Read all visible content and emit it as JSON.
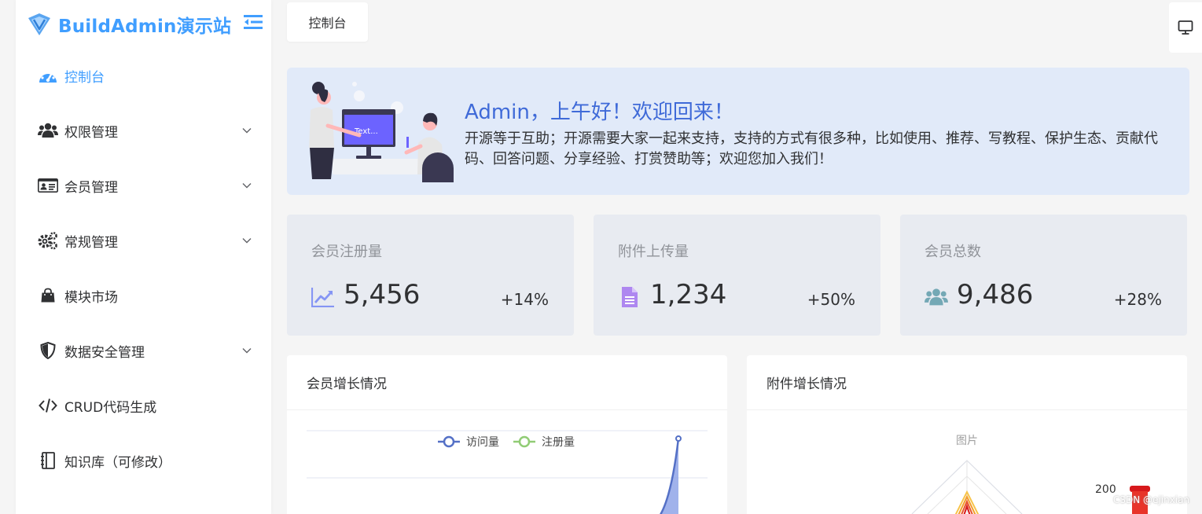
{
  "brand": {
    "name": "BuildAdmin演示站"
  },
  "sidebar": {
    "items": [
      {
        "label": "控制台",
        "icon": "dashboard-icon",
        "active": true,
        "has_children": false
      },
      {
        "label": "权限管理",
        "icon": "users-icon",
        "active": false,
        "has_children": true
      },
      {
        "label": "会员管理",
        "icon": "id-card-icon",
        "active": false,
        "has_children": true
      },
      {
        "label": "常规管理",
        "icon": "cogs-icon",
        "active": false,
        "has_children": true
      },
      {
        "label": "模块市场",
        "icon": "shopping-bag-icon",
        "active": false,
        "has_children": false
      },
      {
        "label": "数据安全管理",
        "icon": "shield-icon",
        "active": false,
        "has_children": true
      },
      {
        "label": "CRUD代码生成",
        "icon": "code-icon",
        "active": false,
        "has_children": false
      },
      {
        "label": "知识库（可修改）",
        "icon": "notebook-icon",
        "active": false,
        "has_children": false
      }
    ]
  },
  "tabs": [
    {
      "label": "控制台"
    }
  ],
  "welcome": {
    "title": "Admin，上午好！欢迎回来！",
    "desc": "开源等于互助；开源需要大家一起来支持，支持的方式有很多种，比如使用、推荐、写教程、保护生态、贡献代码、回答问题、分享经验、打赏赞助等；欢迎您加入我们！",
    "illustration_text": "Text..."
  },
  "stats": [
    {
      "title": "会员注册量",
      "value": "5,456",
      "growth": "+14%",
      "icon": "chart-line-icon",
      "color": "#8595f4"
    },
    {
      "title": "附件上传量",
      "value": "1,234",
      "growth": "+50%",
      "icon": "file-text-icon",
      "color": "#ae87f0"
    },
    {
      "title": "会员总数",
      "value": "9,486",
      "growth": "+28%",
      "icon": "users-icon",
      "color": "#74a8b5"
    }
  ],
  "charts": {
    "member_growth": {
      "title": "会员增长情况",
      "legend": [
        {
          "name": "访问量",
          "color": "#5470c6"
        },
        {
          "name": "注册量",
          "color": "#91cc75"
        }
      ]
    },
    "file_growth": {
      "title": "附件增长情况",
      "subtitle": "图片",
      "visual_map_max": "200"
    }
  },
  "watermark": "CSDN @ejinxian",
  "colors": {
    "accent": "#409eff",
    "welcome_bg": "#e1eaf9",
    "stat_bg": "#e8ebf1"
  }
}
